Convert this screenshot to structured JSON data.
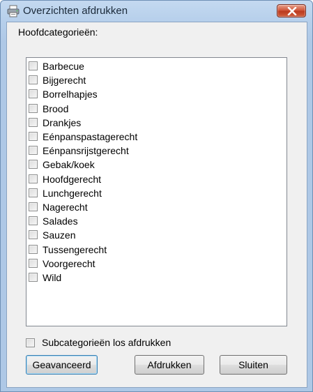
{
  "window": {
    "title": "Overzichten afdrukken"
  },
  "icons": {
    "app": "printer-icon",
    "close": "close-icon"
  },
  "colors": {
    "close_button": "#c9482f",
    "titlebar": "#b9d1ea",
    "client": "#f0f0f0"
  },
  "main": {
    "categories_label": "Hoofdcategorieën:",
    "categories": [
      {
        "label": "Barbecue",
        "checked": false
      },
      {
        "label": "Bijgerecht",
        "checked": false
      },
      {
        "label": "Borrelhapjes",
        "checked": false
      },
      {
        "label": "Brood",
        "checked": false
      },
      {
        "label": "Drankjes",
        "checked": false
      },
      {
        "label": "Eénpanspastagerecht",
        "checked": false
      },
      {
        "label": "Eénpansrijstgerecht",
        "checked": false
      },
      {
        "label": "Gebak/koek",
        "checked": false
      },
      {
        "label": "Hoofdgerecht",
        "checked": false
      },
      {
        "label": "Lunchgerecht",
        "checked": false
      },
      {
        "label": "Nagerecht",
        "checked": false
      },
      {
        "label": "Salades",
        "checked": false
      },
      {
        "label": "Sauzen",
        "checked": false
      },
      {
        "label": "Tussengerecht",
        "checked": false
      },
      {
        "label": "Voorgerecht",
        "checked": false
      },
      {
        "label": "Wild",
        "checked": false
      }
    ],
    "subcategories_option": {
      "label": "Subcategorieën los afdrukken",
      "checked": false
    }
  },
  "buttons": {
    "advanced": "Geavanceerd",
    "print": "Afdrukken",
    "close": "Sluiten"
  }
}
